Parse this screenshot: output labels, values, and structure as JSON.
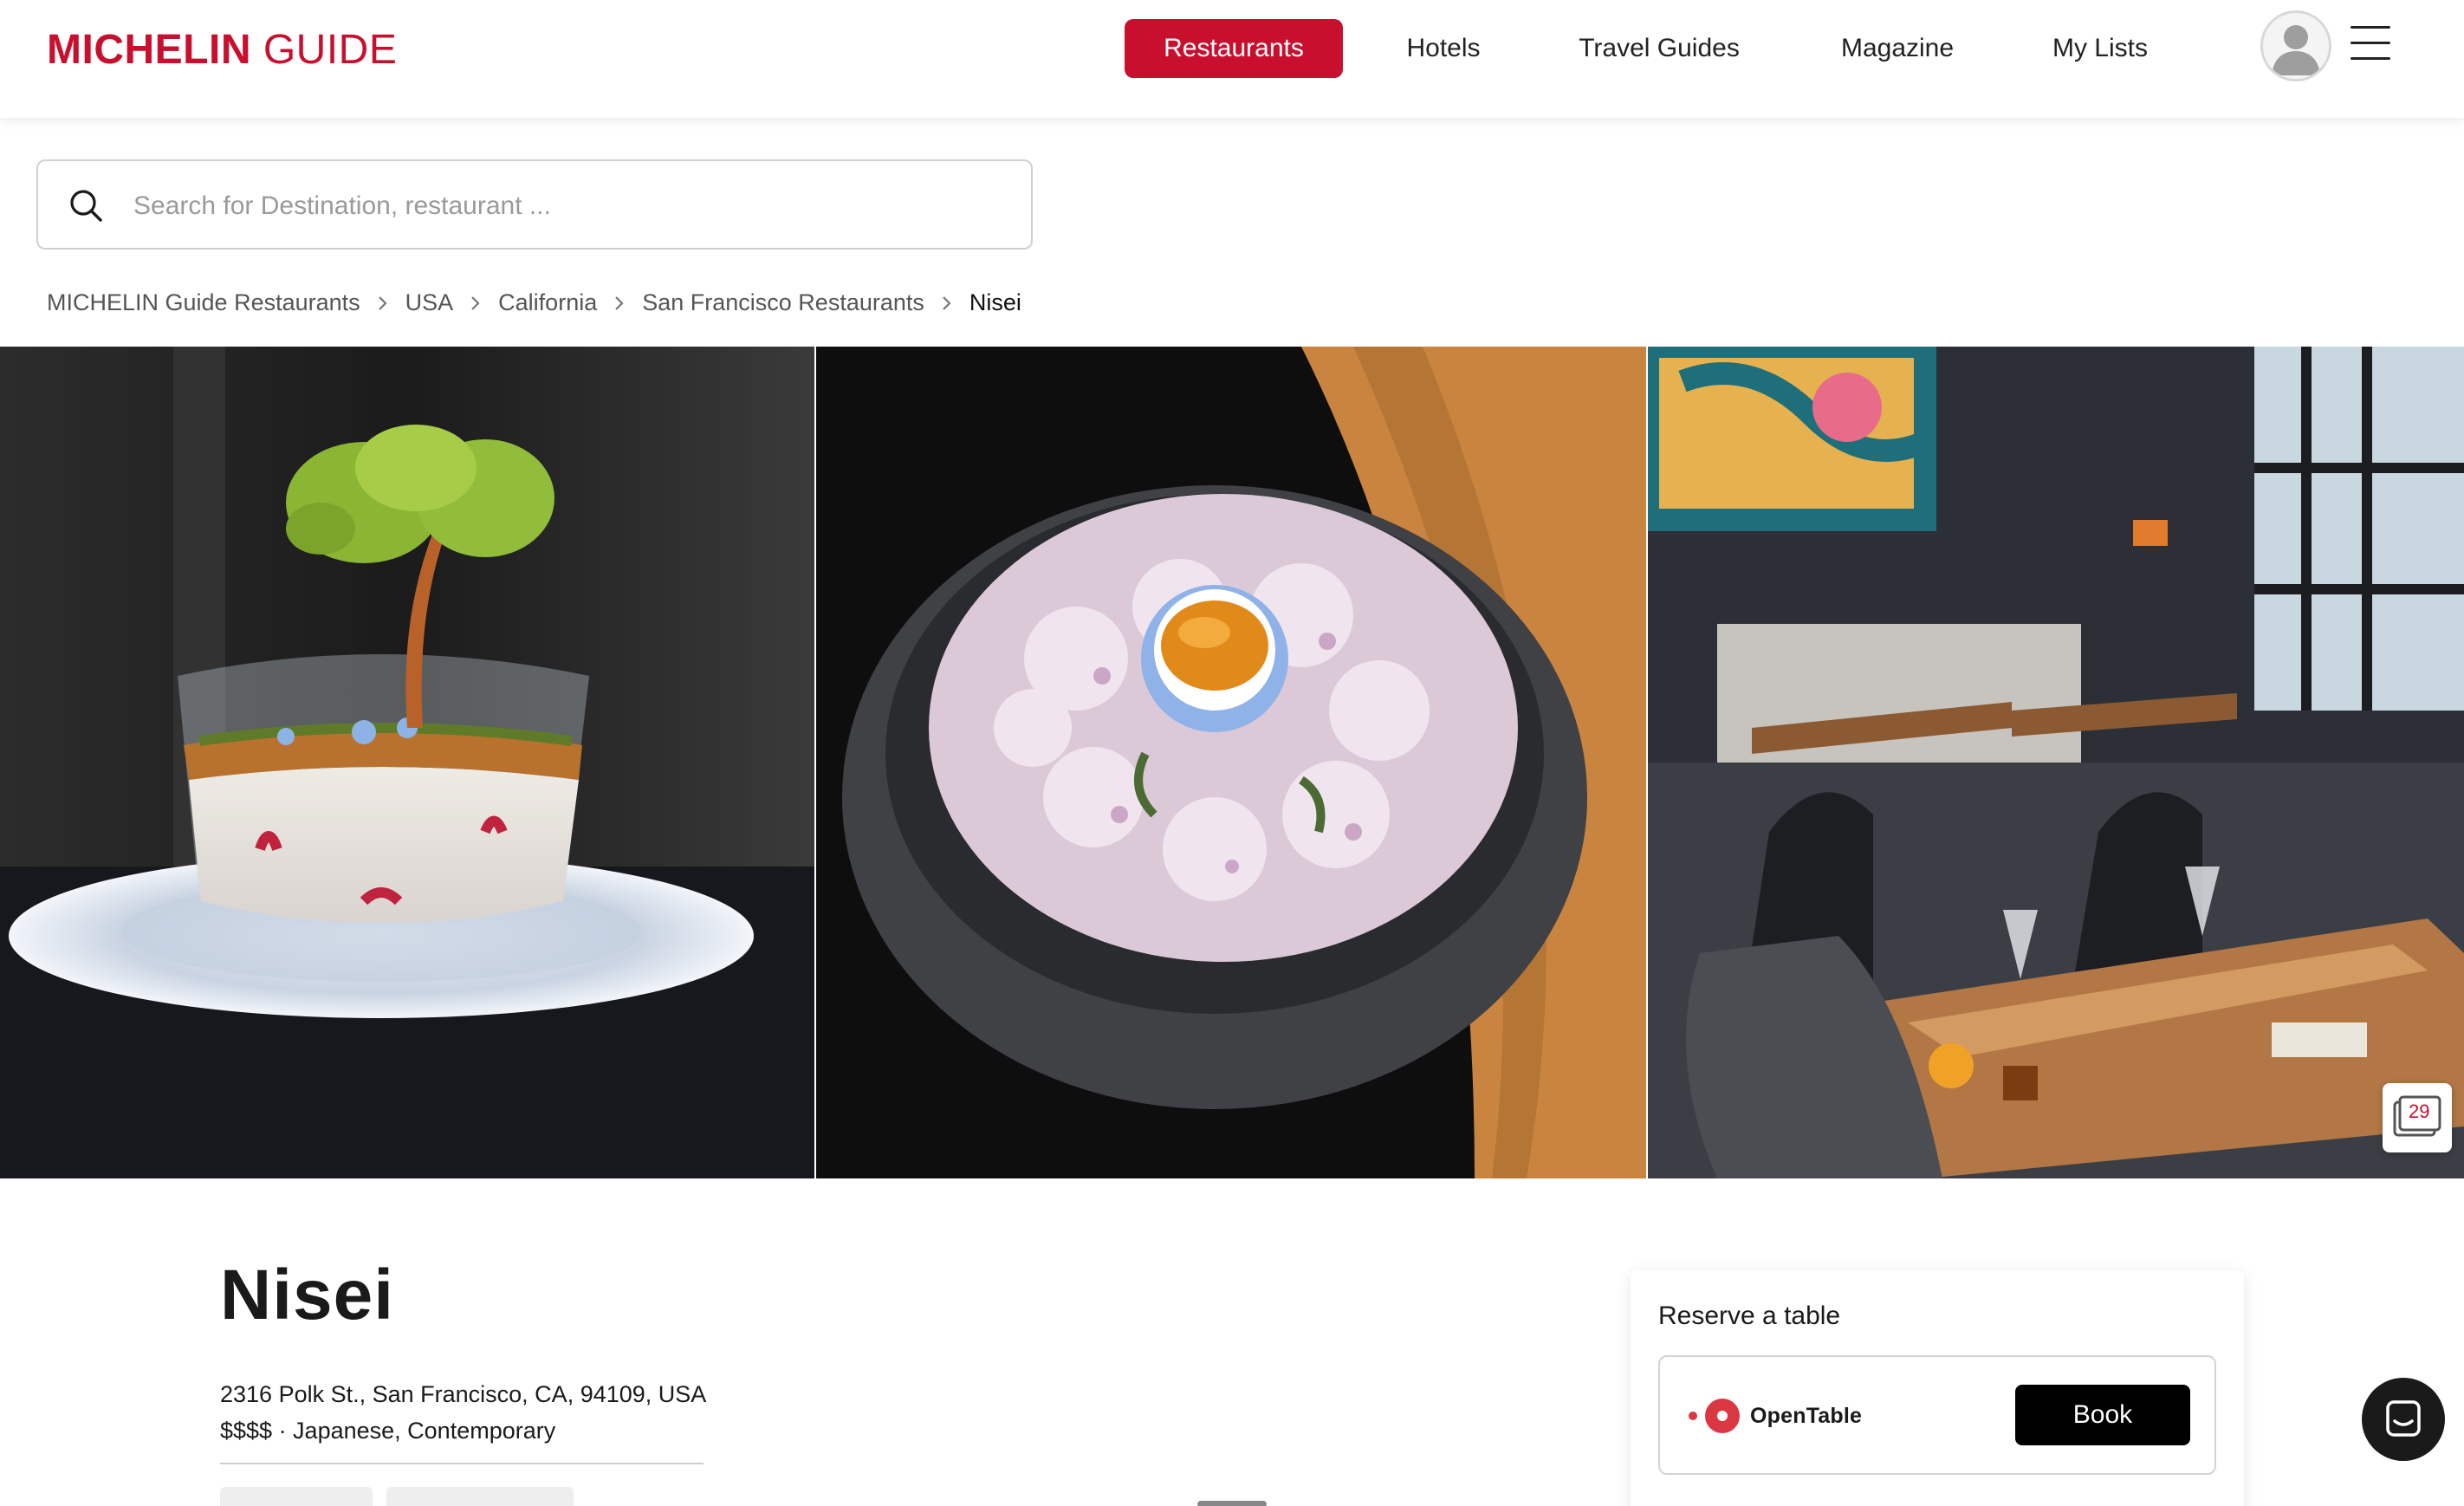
{
  "header": {
    "logo_bold": "MICHELIN",
    "logo_light": " GUIDE",
    "nav": [
      {
        "label": "Restaurants",
        "active": true
      },
      {
        "label": "Hotels",
        "active": false
      },
      {
        "label": "Travel Guides",
        "active": false
      },
      {
        "label": "Magazine",
        "active": false
      },
      {
        "label": "My Lists",
        "active": false
      }
    ],
    "accent_color": "#c8102e"
  },
  "search": {
    "placeholder": "Search for Destination, restaurant ...",
    "value": ""
  },
  "breadcrumb": [
    "MICHELIN Guide Restaurants",
    "USA",
    "California",
    "San Francisco Restaurants",
    "Nisei"
  ],
  "gallery": {
    "photo_count": "29",
    "photos": [
      "dessert-tree-in-glass",
      "uni-flower-bowl",
      "dining-room-interior"
    ]
  },
  "restaurant": {
    "name": "Nisei",
    "address": "2316 Polk St., San Francisco, CA, 94109, USA",
    "price_cuisine": "$$$$ · Japanese, Contemporary"
  },
  "reservation": {
    "title": "Reserve a table",
    "provider": "OpenTable",
    "provider_mark": "·",
    "book_label": "Book"
  },
  "icons": {
    "search": "search-icon",
    "avatar": "user-avatar-icon",
    "menu": "hamburger-menu-icon",
    "gallery": "photo-gallery-icon",
    "chat": "chat-icon",
    "chevron": "chevron-right-icon"
  }
}
